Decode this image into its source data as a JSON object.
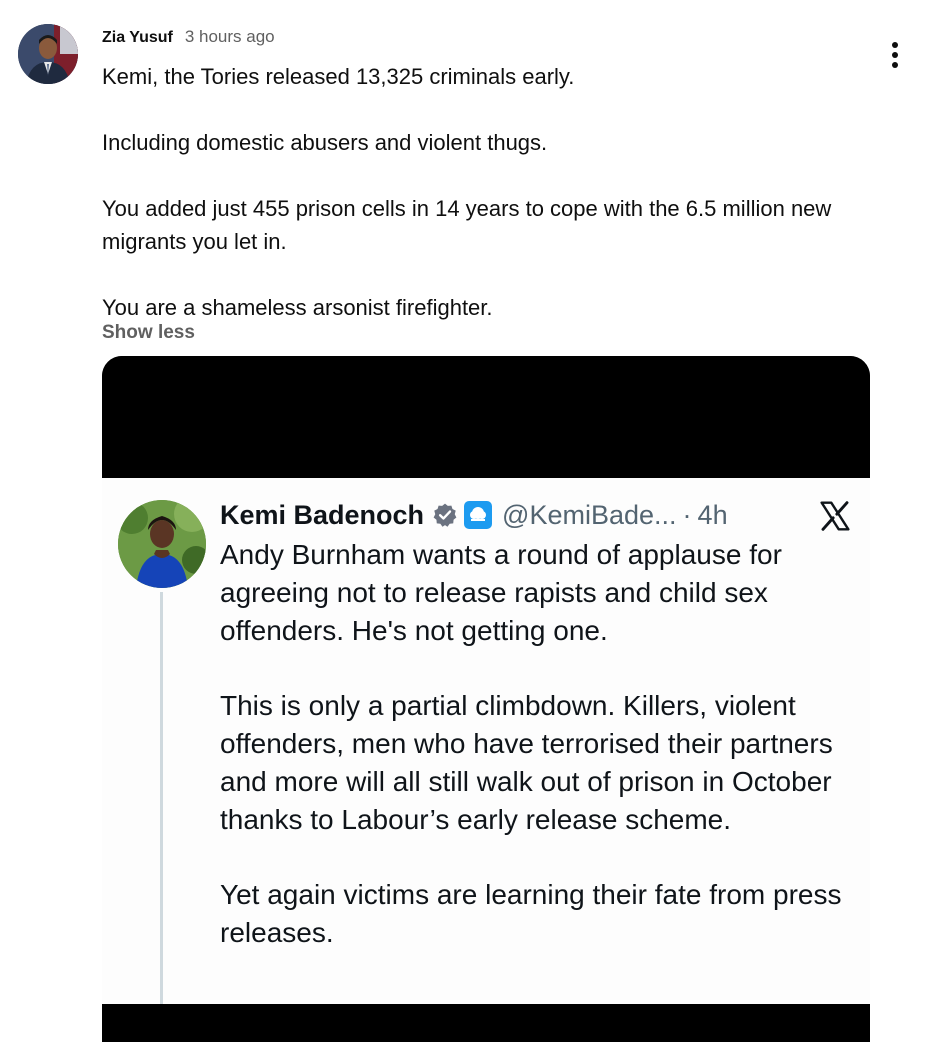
{
  "comment": {
    "author": "Zia Yusuf",
    "time": "3 hours ago",
    "paragraphs": [
      "Kemi, the Tories released 13,325 criminals early.",
      "Including domestic abusers and violent thugs.",
      "You added just 455 prison cells in 14 years to cope with the 6.5 million new migrants you let in.",
      "You are a shameless arsonist firefighter."
    ],
    "show_less_label": "Show less",
    "menu_icon": "more-vertical-icon"
  },
  "embedded_tweet": {
    "name": "Kemi Badenoch",
    "handle": "@KemiBade...",
    "separator": "·",
    "time": "4h",
    "verified_icon": "verified-badge-icon",
    "org_icon": "affiliate-badge-icon",
    "platform_icon": "x-logo-icon",
    "paragraphs": [
      "Andy Burnham wants a round of applause for agreeing not to release rapists and child sex offenders. He's not getting one.",
      "This is only a partial climbdown. Killers, violent offenders, men who have terrorised their partners and more will all still walk out of prison in October thanks to Labour’s early release scheme.",
      "Yet again victims are learning their fate from press releases."
    ]
  },
  "colors": {
    "text_primary": "#0f0f0f",
    "text_secondary": "#606060",
    "tweet_text": "#0f1419",
    "tweet_secondary": "#536471",
    "verified_blue": "#1d9bf0",
    "media_background": "#000000"
  }
}
